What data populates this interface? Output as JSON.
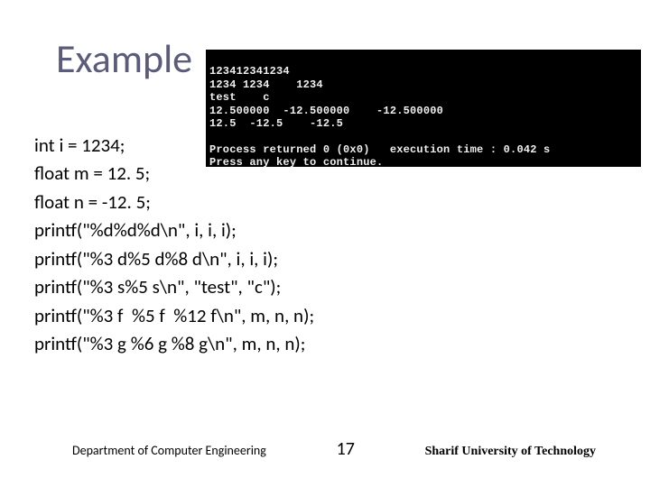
{
  "title": "Example",
  "code": {
    "l1": "int i = 1234;",
    "l2": "float m = 12. 5;",
    "l3": "float n = -12. 5;",
    "l4": "printf(\"%d%d%d\\n\", i, i, i);",
    "l5": "printf(\"%3 d%5 d%8 d\\n\", i, i, i);",
    "l6": "printf(\"%3 s%5 s\\n\", \"test\", \"c\");",
    "l7": "printf(\"%3 f  %5 f  %12 f\\n\", m, n, n);",
    "l8": "printf(\"%3 g %6 g %8 g\\n\", m, n, n);"
  },
  "console": {
    "l1": "123412341234",
    "l2": "1234 1234    1234",
    "l3": "test    c",
    "l4": "12.500000  -12.500000    -12.500000",
    "l5": "12.5  -12.5    -12.5",
    "l6": "",
    "l7": "Process returned 0 (0x0)   execution time : 0.042 s",
    "l8": "Press any key to continue."
  },
  "footer": {
    "dept": "Department of Computer Engineering",
    "page": "17",
    "uni": "Sharif University of Technology"
  }
}
